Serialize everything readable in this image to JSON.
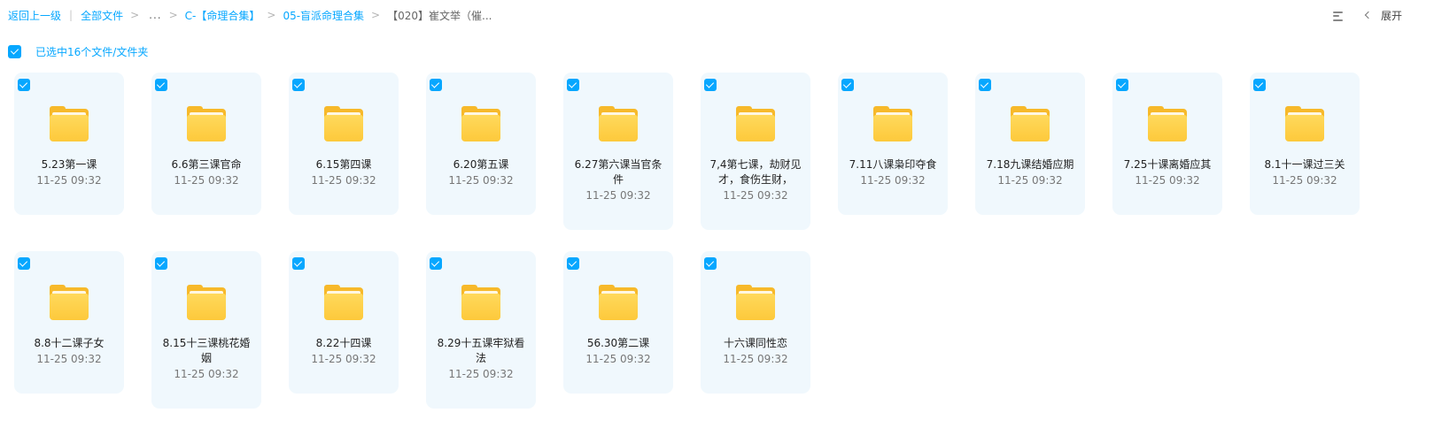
{
  "breadcrumb": {
    "back_label": "返回上一级",
    "sep": "|",
    "all_files": "全部文件",
    "gt": ">",
    "ellipsis": "...",
    "c_folder": "C-【命理合集】",
    "mang_folder": "05-盲派命理合集",
    "current": "【020】崔文举（催..."
  },
  "toolbar": {
    "expand_label": "展开",
    "list_icon": "list-view-icon",
    "chevron_icon": "chevron-left-icon"
  },
  "selection": {
    "label": "已选中16个文件/文件夹",
    "checked": true
  },
  "colors": {
    "accent": "#06a7ff",
    "card_bg": "#f0f8fd",
    "folder": "#fdc93b"
  },
  "files": [
    {
      "name": "5.23第一课",
      "date": "11-25 09:32"
    },
    {
      "name": "6.6第三课官命",
      "date": "11-25 09:32"
    },
    {
      "name": "6.15第四课",
      "date": "11-25 09:32"
    },
    {
      "name": "6.20第五课",
      "date": "11-25 09:32"
    },
    {
      "name": "6.27第六课当官条件",
      "date": "11-25 09:32"
    },
    {
      "name": "7,4第七课，劫财见才，食伤生财，",
      "date": "11-25 09:32"
    },
    {
      "name": "7.11八课枭印夺食",
      "date": "11-25 09:32"
    },
    {
      "name": "7.18九课结婚应期",
      "date": "11-25 09:32"
    },
    {
      "name": "7.25十课离婚应其",
      "date": "11-25 09:32"
    },
    {
      "name": "8.1十一课过三关",
      "date": "11-25 09:32"
    },
    {
      "name": "8.8十二课子女",
      "date": "11-25 09:32"
    },
    {
      "name": "8.15十三课桃花婚姻",
      "date": "11-25 09:32"
    },
    {
      "name": "8.22十四课",
      "date": "11-25 09:32"
    },
    {
      "name": "8.29十五课牢狱看法",
      "date": "11-25 09:32"
    },
    {
      "name": "56.30第二课",
      "date": "11-25 09:32"
    },
    {
      "name": "十六课同性恋",
      "date": "11-25 09:32"
    }
  ]
}
